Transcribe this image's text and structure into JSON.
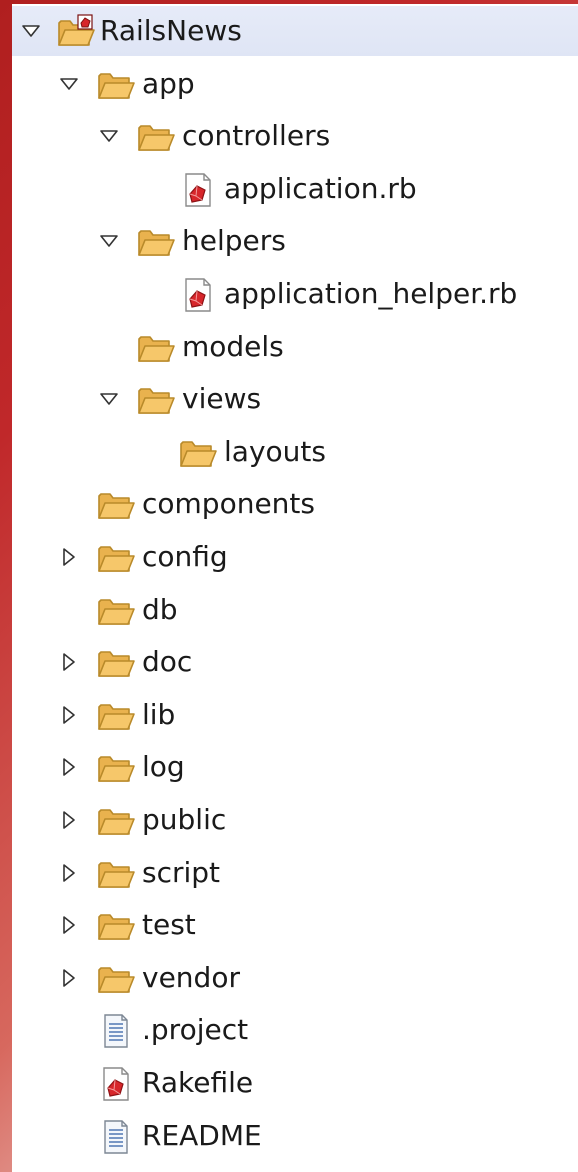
{
  "tree": {
    "root": {
      "label": "RailsNews",
      "icon": "ruby-project-icon",
      "expanded": true
    },
    "nodes": [
      {
        "label": "app",
        "type": "folder",
        "depth": 1,
        "expander": "expanded"
      },
      {
        "label": "controllers",
        "type": "folder",
        "depth": 2,
        "expander": "expanded"
      },
      {
        "label": "application.rb",
        "type": "ruby-file",
        "depth": 3,
        "expander": "none"
      },
      {
        "label": "helpers",
        "type": "folder",
        "depth": 2,
        "expander": "expanded"
      },
      {
        "label": "application_helper.rb",
        "type": "ruby-file",
        "depth": 3,
        "expander": "none"
      },
      {
        "label": "models",
        "type": "folder",
        "depth": 2,
        "expander": "none"
      },
      {
        "label": "views",
        "type": "folder",
        "depth": 2,
        "expander": "expanded"
      },
      {
        "label": "layouts",
        "type": "folder",
        "depth": 3,
        "expander": "none"
      },
      {
        "label": "components",
        "type": "folder",
        "depth": 1,
        "expander": "none"
      },
      {
        "label": "config",
        "type": "folder",
        "depth": 1,
        "expander": "collapsed"
      },
      {
        "label": "db",
        "type": "folder",
        "depth": 1,
        "expander": "none"
      },
      {
        "label": "doc",
        "type": "folder",
        "depth": 1,
        "expander": "collapsed"
      },
      {
        "label": "lib",
        "type": "folder",
        "depth": 1,
        "expander": "collapsed"
      },
      {
        "label": "log",
        "type": "folder",
        "depth": 1,
        "expander": "collapsed"
      },
      {
        "label": "public",
        "type": "folder",
        "depth": 1,
        "expander": "collapsed"
      },
      {
        "label": "script",
        "type": "folder",
        "depth": 1,
        "expander": "collapsed"
      },
      {
        "label": "test",
        "type": "folder",
        "depth": 1,
        "expander": "collapsed"
      },
      {
        "label": "vendor",
        "type": "folder",
        "depth": 1,
        "expander": "collapsed"
      },
      {
        "label": ".project",
        "type": "text-file",
        "depth": 1,
        "expander": "none"
      },
      {
        "label": "Rakefile",
        "type": "ruby-file",
        "depth": 1,
        "expander": "none"
      },
      {
        "label": "README",
        "type": "text-file",
        "depth": 1,
        "expander": "none"
      }
    ]
  },
  "colors": {
    "folder_fill": "#f6c76a",
    "folder_stroke": "#b98a2a",
    "ruby_red": "#d7262b",
    "selection": "#e3e8f6",
    "text": "#1a1a1a"
  }
}
